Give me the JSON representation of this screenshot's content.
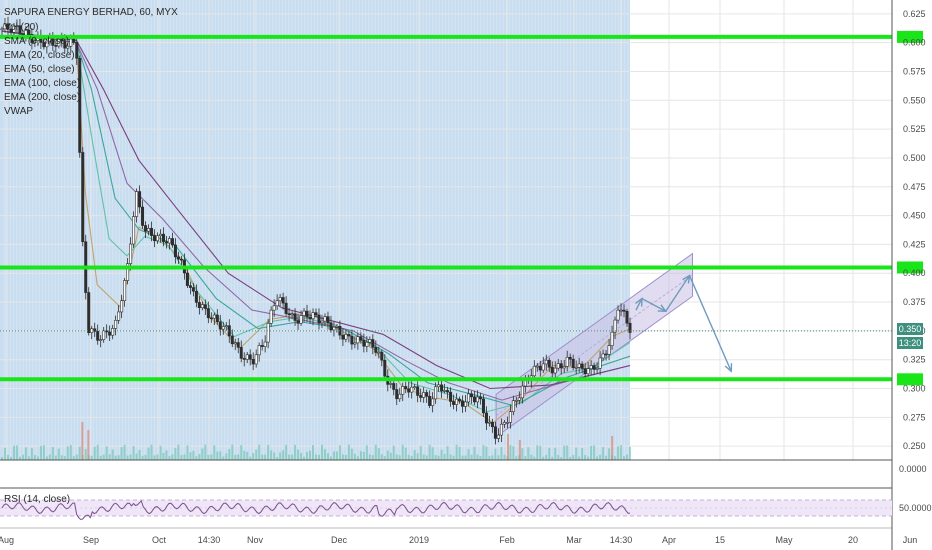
{
  "legend": {
    "title": "SAPURA ENERGY BERHAD, 60, MYX",
    "lines": [
      "Vol (20)",
      "SMA (9, close)",
      "EMA (20, close)",
      "EMA (50, close)",
      "EMA (100, close)",
      "EMA (200, close)",
      "VWAP"
    ]
  },
  "rsi_legend": "RSI (14, close)",
  "price_badge": {
    "value": "0.350",
    "countdown": "13:20"
  },
  "colors": {
    "session_bg": "#c9ddf0",
    "support_resistance": "#19e619",
    "candle": "#2d2d2d",
    "sma": "#c2a36b",
    "ema20": "#5fc2a8",
    "ema50": "#3aa79a",
    "ema100": "#8f6aa8",
    "ema200": "#7a3f7f",
    "channel_fill": "#c8bfe3",
    "arrows": "#6f9bbf",
    "rsi_line": "#7b4e8e",
    "rsi_band": "#efe6f7",
    "volume": "#5bbfa2"
  },
  "chart_data": {
    "type": "candlestick",
    "symbol": "SAPURA ENERGY BERHAD",
    "interval": "60",
    "exchange": "MYX",
    "x_tick_labels": [
      "Aug",
      "Sep",
      "Oct",
      "14:30",
      "Nov",
      "Dec",
      "2019",
      "Feb",
      "Mar",
      "14:30",
      "Apr",
      "15",
      "May",
      "20",
      "Jun"
    ],
    "y_tick_labels": [
      "0.625",
      "0.600",
      "0.575",
      "0.550",
      "0.525",
      "0.500",
      "0.475",
      "0.450",
      "0.425",
      "0.400",
      "0.375",
      "0.350",
      "0.325",
      "0.300",
      "0.275",
      "0.250"
    ],
    "ylim": [
      0.238,
      0.637
    ],
    "price_path": [
      [
        0,
        0.612
      ],
      [
        6,
        0.608
      ],
      [
        14,
        0.603
      ],
      [
        22,
        0.595
      ],
      [
        25,
        0.6
      ],
      [
        27,
        0.43
      ],
      [
        29,
        0.355
      ],
      [
        33,
        0.345
      ],
      [
        38,
        0.35
      ],
      [
        42,
        0.4
      ],
      [
        45,
        0.472
      ],
      [
        48,
        0.44
      ],
      [
        52,
        0.43
      ],
      [
        56,
        0.425
      ],
      [
        60,
        0.41
      ],
      [
        64,
        0.385
      ],
      [
        68,
        0.368
      ],
      [
        72,
        0.355
      ],
      [
        76,
        0.348
      ],
      [
        80,
        0.333
      ],
      [
        84,
        0.325
      ],
      [
        88,
        0.337
      ],
      [
        92,
        0.378
      ],
      [
        95,
        0.372
      ],
      [
        98,
        0.362
      ],
      [
        102,
        0.365
      ],
      [
        106,
        0.358
      ],
      [
        110,
        0.355
      ],
      [
        114,
        0.35
      ],
      [
        118,
        0.343
      ],
      [
        122,
        0.338
      ],
      [
        126,
        0.332
      ],
      [
        130,
        0.305
      ],
      [
        133,
        0.297
      ],
      [
        136,
        0.302
      ],
      [
        140,
        0.293
      ],
      [
        144,
        0.287
      ],
      [
        147,
        0.307
      ],
      [
        150,
        0.295
      ],
      [
        154,
        0.286
      ],
      [
        157,
        0.289
      ],
      [
        160,
        0.29
      ],
      [
        163,
        0.273
      ],
      [
        166,
        0.262
      ],
      [
        169,
        0.272
      ],
      [
        172,
        0.285
      ],
      [
        175,
        0.298
      ],
      [
        178,
        0.313
      ],
      [
        182,
        0.325
      ],
      [
        186,
        0.318
      ],
      [
        190,
        0.322
      ],
      [
        194,
        0.315
      ],
      [
        198,
        0.318
      ],
      [
        202,
        0.33
      ],
      [
        205,
        0.345
      ],
      [
        207,
        0.37
      ],
      [
        209,
        0.36
      ],
      [
        211,
        0.35
      ]
    ],
    "index_span": [
      0,
      211
    ],
    "forecast_index_span": [
      211,
      310
    ],
    "horizontal_levels": [
      0.605,
      0.405,
      0.308
    ],
    "current_price": 0.35,
    "channel": {
      "lower": [
        [
          166,
          0.258
        ],
        [
          232,
          0.38
        ]
      ],
      "upper": [
        [
          166,
          0.295
        ],
        [
          232,
          0.417
        ]
      ]
    },
    "forecast_path": [
      [
        213,
        0.368
      ],
      [
        215,
        0.378
      ],
      [
        223,
        0.367
      ],
      [
        231,
        0.398
      ],
      [
        245,
        0.315
      ]
    ],
    "moving_averages": [
      {
        "name": "SMA (9, close)",
        "points": [
          [
            0,
            0.61
          ],
          [
            25,
            0.6
          ],
          [
            28,
            0.47
          ],
          [
            32,
            0.39
          ],
          [
            40,
            0.37
          ],
          [
            46,
            0.44
          ],
          [
            52,
            0.432
          ],
          [
            60,
            0.413
          ],
          [
            70,
            0.362
          ],
          [
            80,
            0.335
          ],
          [
            90,
            0.36
          ],
          [
            100,
            0.364
          ],
          [
            112,
            0.353
          ],
          [
            125,
            0.334
          ],
          [
            135,
            0.3
          ],
          [
            145,
            0.292
          ],
          [
            155,
            0.288
          ],
          [
            165,
            0.27
          ],
          [
            175,
            0.292
          ],
          [
            185,
            0.32
          ],
          [
            195,
            0.318
          ],
          [
            205,
            0.345
          ],
          [
            211,
            0.352
          ]
        ]
      },
      {
        "name": "EMA (20, close)",
        "points": [
          [
            0,
            0.61
          ],
          [
            25,
            0.6
          ],
          [
            30,
            0.52
          ],
          [
            36,
            0.43
          ],
          [
            42,
            0.415
          ],
          [
            48,
            0.432
          ],
          [
            56,
            0.424
          ],
          [
            66,
            0.383
          ],
          [
            78,
            0.345
          ],
          [
            90,
            0.358
          ],
          [
            100,
            0.362
          ],
          [
            112,
            0.355
          ],
          [
            125,
            0.338
          ],
          [
            137,
            0.305
          ],
          [
            150,
            0.295
          ],
          [
            163,
            0.28
          ],
          [
            175,
            0.288
          ],
          [
            188,
            0.313
          ],
          [
            198,
            0.318
          ],
          [
            211,
            0.34
          ]
        ]
      },
      {
        "name": "EMA (50, close)",
        "points": [
          [
            0,
            0.61
          ],
          [
            25,
            0.6
          ],
          [
            30,
            0.56
          ],
          [
            38,
            0.465
          ],
          [
            46,
            0.438
          ],
          [
            58,
            0.425
          ],
          [
            72,
            0.378
          ],
          [
            86,
            0.352
          ],
          [
            100,
            0.358
          ],
          [
            115,
            0.352
          ],
          [
            130,
            0.33
          ],
          [
            143,
            0.305
          ],
          [
            158,
            0.295
          ],
          [
            172,
            0.285
          ],
          [
            190,
            0.31
          ],
          [
            211,
            0.328
          ]
        ]
      },
      {
        "name": "EMA (100, close)",
        "points": [
          [
            0,
            0.61
          ],
          [
            25,
            0.6
          ],
          [
            32,
            0.56
          ],
          [
            42,
            0.478
          ],
          [
            54,
            0.447
          ],
          [
            68,
            0.405
          ],
          [
            84,
            0.368
          ],
          [
            100,
            0.36
          ],
          [
            118,
            0.35
          ],
          [
            135,
            0.325
          ],
          [
            150,
            0.305
          ],
          [
            168,
            0.29
          ],
          [
            188,
            0.305
          ],
          [
            211,
            0.32
          ]
        ]
      },
      {
        "name": "EMA (200, close)",
        "points": [
          [
            0,
            0.61
          ],
          [
            25,
            0.602
          ],
          [
            34,
            0.56
          ],
          [
            46,
            0.498
          ],
          [
            60,
            0.452
          ],
          [
            76,
            0.4
          ],
          [
            94,
            0.37
          ],
          [
            112,
            0.358
          ],
          [
            128,
            0.347
          ],
          [
            146,
            0.32
          ],
          [
            164,
            0.3
          ],
          [
            184,
            0.303
          ],
          [
            200,
            0.313
          ],
          [
            211,
            0.32
          ]
        ]
      }
    ],
    "volume": {
      "ylim": [
        0,
        1
      ],
      "y_tick_labels": [
        "0.0000"
      ]
    },
    "rsi": {
      "name": "RSI (14, close)",
      "ylim": [
        0,
        100
      ],
      "y_tick_labels": [
        "50.0000"
      ],
      "bands": [
        30,
        70
      ],
      "baseline": 50
    }
  }
}
